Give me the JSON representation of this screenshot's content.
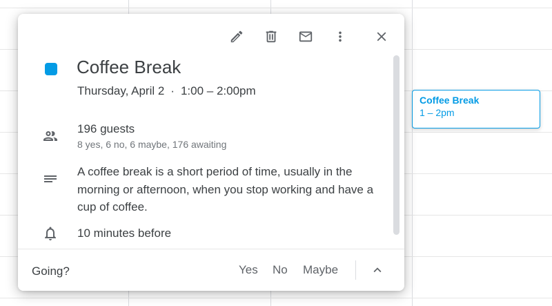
{
  "event": {
    "title": "Coffee Break",
    "date": "Thursday, April 2",
    "separator": "·",
    "time": "1:00 – 2:00pm",
    "color": "#039be5"
  },
  "guests": {
    "count": "196 guests",
    "detail": "8 yes, 6 no, 6 maybe, 176 awaiting"
  },
  "description": "A coffee break is a short period of time, usually in the morning or afternoon, when you stop working and have a cup of coffee.",
  "reminder": "10 minutes before",
  "toolbar": {
    "icons": [
      "edit-icon",
      "delete-icon",
      "email-icon",
      "more-options-icon",
      "close-icon"
    ]
  },
  "footer": {
    "going_label": "Going?",
    "yes": "Yes",
    "no": "No",
    "maybe": "Maybe"
  },
  "calendar_chip": {
    "title": "Coffee Break",
    "time": "1 – 2pm"
  }
}
